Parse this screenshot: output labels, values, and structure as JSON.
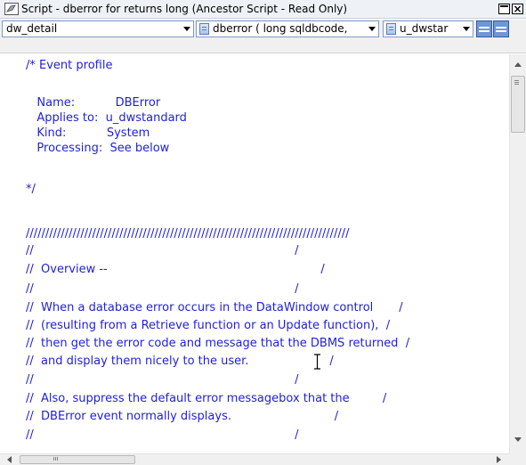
{
  "window": {
    "title": "Script - dberror for  returns long (Ancestor Script - Read Only)"
  },
  "toolbar": {
    "object_select": "dw_detail",
    "event_select": "dberror ( long sqldbcode, ",
    "ancestor_select": "u_dwstar"
  },
  "code": {
    "lines": [
      "/* Event profile",
      "",
      "   Name:           DBError",
      "   Applies to:  u_dwstandard",
      "   Kind:           System",
      "   Processing:  See below",
      "",
      "*/",
      "",
      "///////////////////////////////////////////////////////////////////////////////////",
      "//                                                                       /",
      "//  Overview --                                                          /",
      "//                                                                       /",
      "//  When a database error occurs in the DataWindow control       /",
      "//  (resulting from a Retrieve function or an Update function),  /",
      "//  then get the error code and message that the DBMS returned  /",
      "//  and display them nicely to the user.                      /",
      "//                                                                       /",
      "//  Also, suppress the default error messagebox that the         /",
      "//  DBError event normally displays.                            /",
      "//                                                                       /"
    ]
  },
  "colors": {
    "code_text": "#1f1fd8",
    "title_bar": "#eef2f7"
  }
}
